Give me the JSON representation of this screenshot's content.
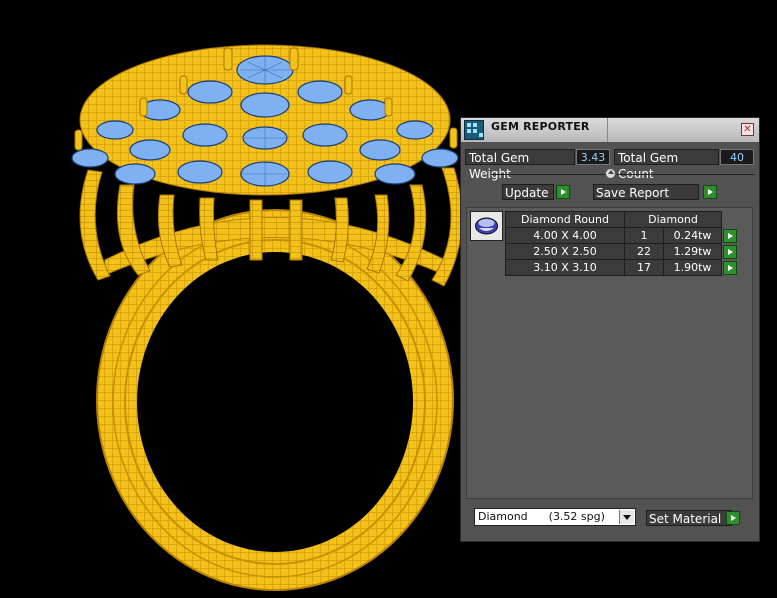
{
  "panel": {
    "title": "GEM REPORTER",
    "close_glyph": "✕",
    "total_weight_label": "Total Gem Weight",
    "total_weight_value": "3.43",
    "total_count_label": "Total Gem Count",
    "total_count_value": "40",
    "update_label": "Update",
    "save_report_label": "Save Report",
    "table": {
      "headers": [
        "Diamond Round",
        "Diamond"
      ],
      "rows": [
        {
          "size": "4.00 X 4.00",
          "count": "1",
          "weight": "0.24tw"
        },
        {
          "size": "2.50 X 2.50",
          "count": "22",
          "weight": "1.29tw"
        },
        {
          "size": "3.10 X 3.10",
          "count": "17",
          "weight": "1.90tw"
        }
      ]
    },
    "material_select": "Diamond      (3.52 spg)",
    "set_material_label": "Set Material"
  },
  "colors": {
    "gold": "#f2c21a",
    "gold_wire": "#c88f00",
    "gem_blue": "#7fb1f2",
    "panel_bg": "#525252",
    "go_green": "#2f8f2f"
  },
  "icons": [
    "gem-reporter-app-icon",
    "close-icon",
    "slider-knob-icon",
    "arrow-right-icon",
    "gem-thumbnail-icon",
    "dropdown-arrow-icon"
  ]
}
